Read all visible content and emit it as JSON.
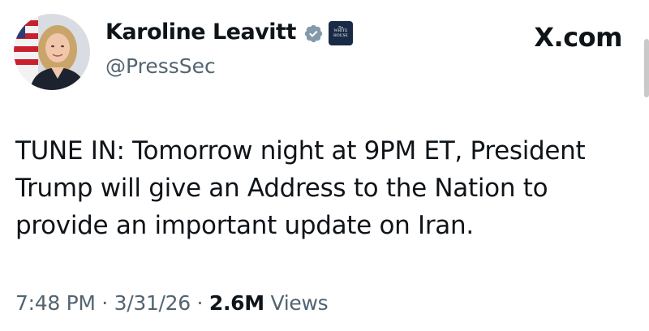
{
  "author": {
    "display_name": "Karoline Leavitt",
    "handle": "@PressSec",
    "affiliate_badge": {
      "line1": "The",
      "line2": "WHITE",
      "line3": "HOUSE"
    },
    "verified_badge_color": "#829aab"
  },
  "source": {
    "label": "X.com"
  },
  "tweet": {
    "text": "TUNE IN: Tomorrow night at 9PM ET, President Trump will give an Address to the Nation to provide an important update on Iran.",
    "time": "7:48 PM",
    "separator": "·",
    "date": "3/31/26",
    "views_count": "2.6M",
    "views_label": "Views"
  },
  "icons": {
    "avatar": "avatar",
    "verified": "verified-badge-icon",
    "affiliate": "white-house-badge-icon"
  }
}
